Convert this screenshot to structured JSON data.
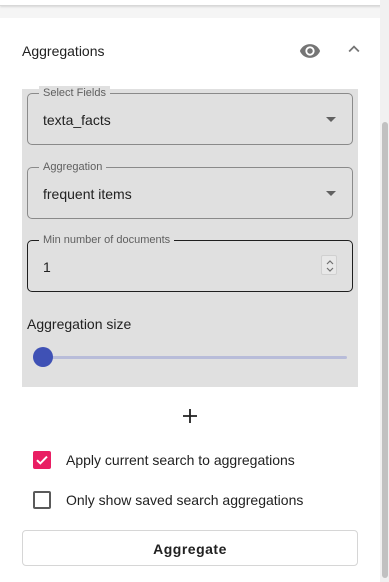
{
  "panel": {
    "title": "Aggregations"
  },
  "fields": {
    "select_fields": {
      "label": "Select Fields",
      "value": "texta_facts"
    },
    "aggregation": {
      "label": "Aggregation",
      "value": "frequent items"
    },
    "min_documents": {
      "label": "Min number of documents",
      "value": "1"
    }
  },
  "aggregation_size": {
    "label": "Aggregation size",
    "level_fraction": 0.0
  },
  "add_button": {
    "symbol": "+"
  },
  "options": {
    "apply_current_search": {
      "label": "Apply current search to aggregations",
      "checked": true
    },
    "only_saved_search": {
      "label": "Only show saved search aggregations",
      "checked": false
    }
  },
  "aggregate_button": {
    "label": "Aggregate"
  },
  "colors": {
    "accent_primary": "#3f51b5",
    "accent_checkbox": "#e91e63",
    "block_background": "#e0e0e0"
  },
  "icons": {
    "visibility": "eye-icon",
    "collapse": "chevron-up-icon",
    "dropdown": "arrow-drop-down-icon",
    "add": "plus-icon"
  }
}
